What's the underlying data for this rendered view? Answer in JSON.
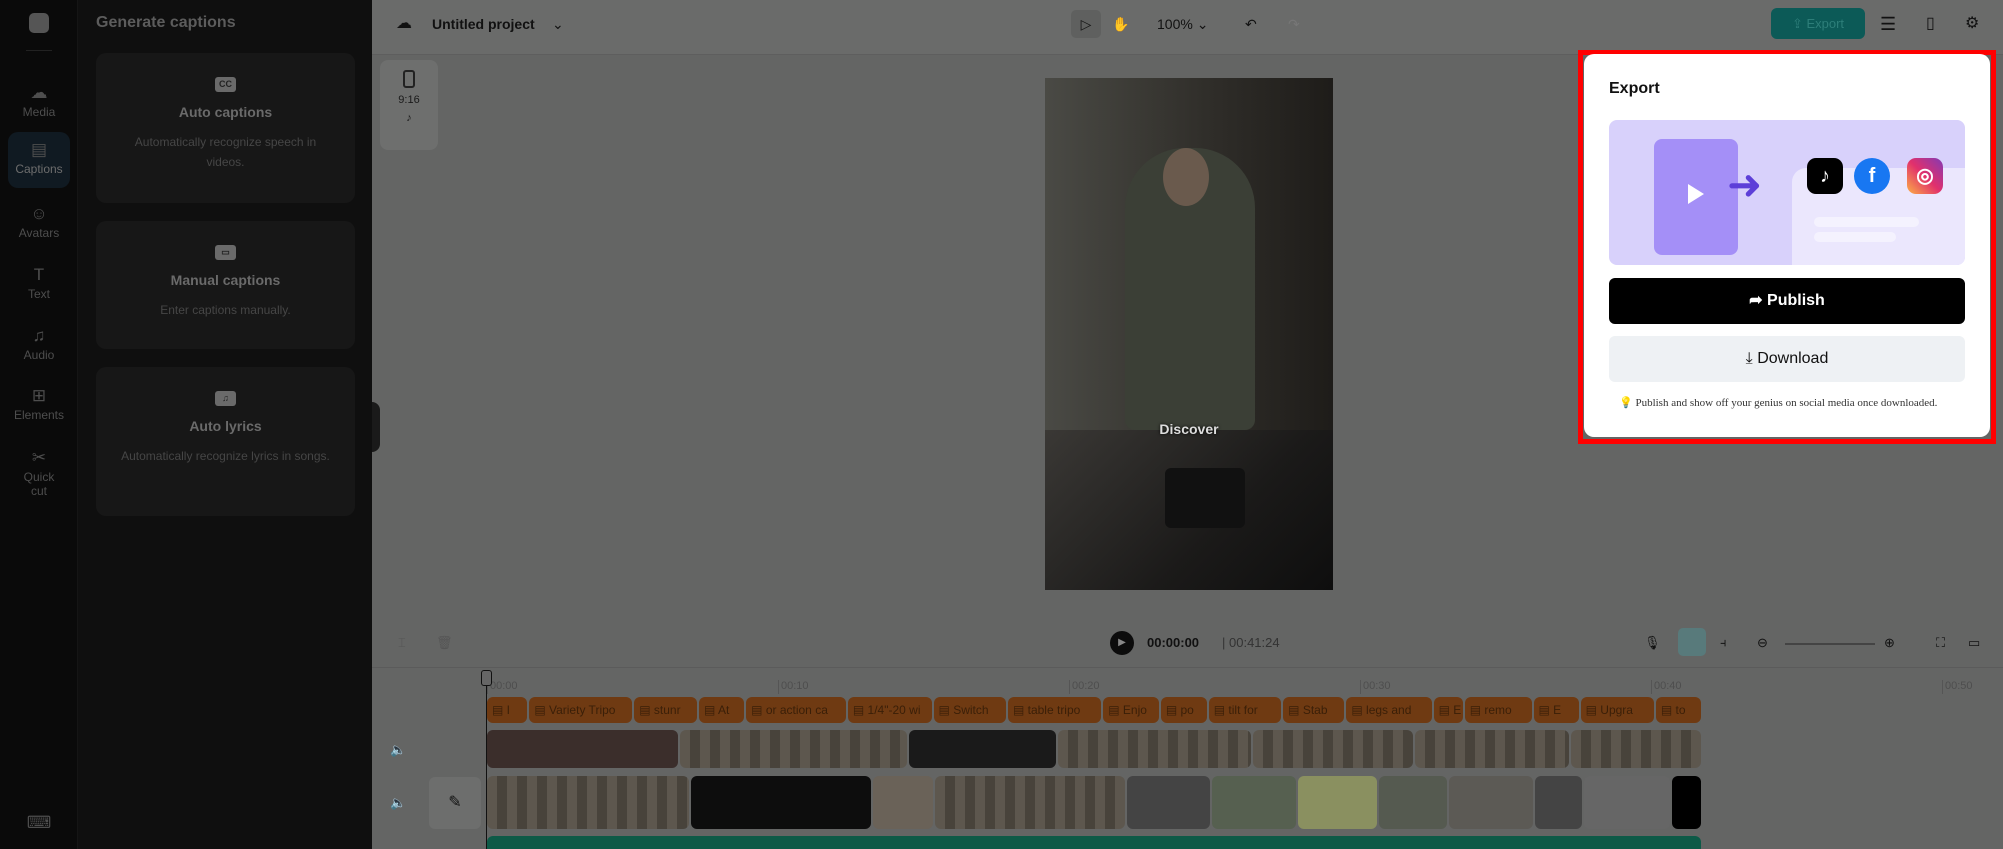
{
  "rail": {
    "items": [
      {
        "label": "Media",
        "icon": "cloud-upload-icon"
      },
      {
        "label": "Captions",
        "icon": "captions-icon"
      },
      {
        "label": "Avatars",
        "icon": "avatar-icon"
      },
      {
        "label": "Text",
        "icon": "text-icon"
      },
      {
        "label": "Audio",
        "icon": "music-icon"
      },
      {
        "label": "Elements",
        "icon": "elements-icon"
      },
      {
        "label": "Quick cut",
        "icon": "quick-cut-icon"
      }
    ]
  },
  "panel": {
    "title": "Generate captions",
    "cards": [
      {
        "title": "Auto captions",
        "desc": "Automatically recognize speech in videos.",
        "icon": "CC"
      },
      {
        "title": "Manual captions",
        "desc": "Enter captions manually.",
        "icon": "▭"
      },
      {
        "title": "Auto lyrics",
        "desc": "Automatically recognize lyrics in songs.",
        "icon": "♫"
      }
    ]
  },
  "topbar": {
    "project": "Untitled project",
    "zoom": "100%",
    "export": "Export"
  },
  "aspect": {
    "ratio": "9:16"
  },
  "video": {
    "subtitle": "Discover"
  },
  "timeline": {
    "current": "00:00:00",
    "total": "00:41:24",
    "ticks": [
      "00:00",
      "00:10",
      "00:20",
      "00:30",
      "00:40",
      "00:50"
    ],
    "captions": [
      "I",
      "Variety Tripo",
      "stunr",
      "At",
      "or action ca",
      "1/4\"-20 wi",
      "Switch",
      "table tripo",
      "Enjo",
      "po",
      "tilt for",
      "Stab",
      "legs and",
      "E",
      "remo",
      "E",
      "Upgra",
      "to"
    ]
  },
  "export": {
    "title": "Export",
    "publish": "Publish",
    "download": "Download",
    "tip": "Publish and show off your genius on social media once downloaded.",
    "social": [
      "TikTok",
      "Facebook",
      "Instagram"
    ]
  }
}
